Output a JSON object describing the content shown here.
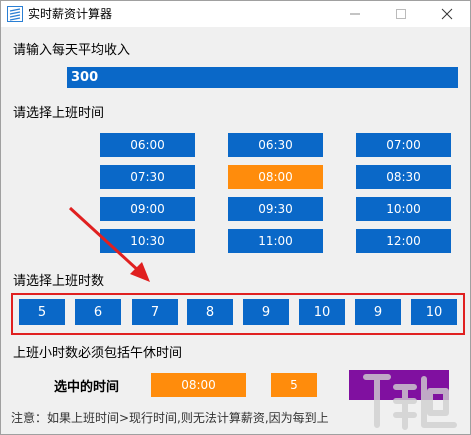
{
  "window": {
    "title": "实时薪资计算器",
    "icon": "app-logo-icon",
    "controls": [
      "minimize-icon",
      "maximize-icon",
      "close-icon"
    ]
  },
  "income": {
    "label": "请输入每天平均收入",
    "value": "300"
  },
  "start_time": {
    "label": "请选择上班时间",
    "options": [
      "06:00",
      "06:30",
      "07:00",
      "07:30",
      "08:00",
      "08:30",
      "09:00",
      "09:30",
      "10:00",
      "10:30",
      "11:00",
      "12:00"
    ],
    "selected": "08:00"
  },
  "work_hours": {
    "label": "请选择上班时数",
    "options": [
      "5",
      "6",
      "7",
      "8",
      "9",
      "10",
      "9",
      "10"
    ]
  },
  "lunch_note": "上班小时数必须包括午休时间",
  "selection": {
    "label": "选中的时间",
    "time": "08:00",
    "hours": "5"
  },
  "notice": "注意：如果上班时间>现行时间,则无法计算薪资,因为每到上",
  "colors": {
    "button_blue": "#0a68c8",
    "selected_orange": "#ff8c0c",
    "highlight_red": "#e02020",
    "purple": "#8010a0"
  }
}
